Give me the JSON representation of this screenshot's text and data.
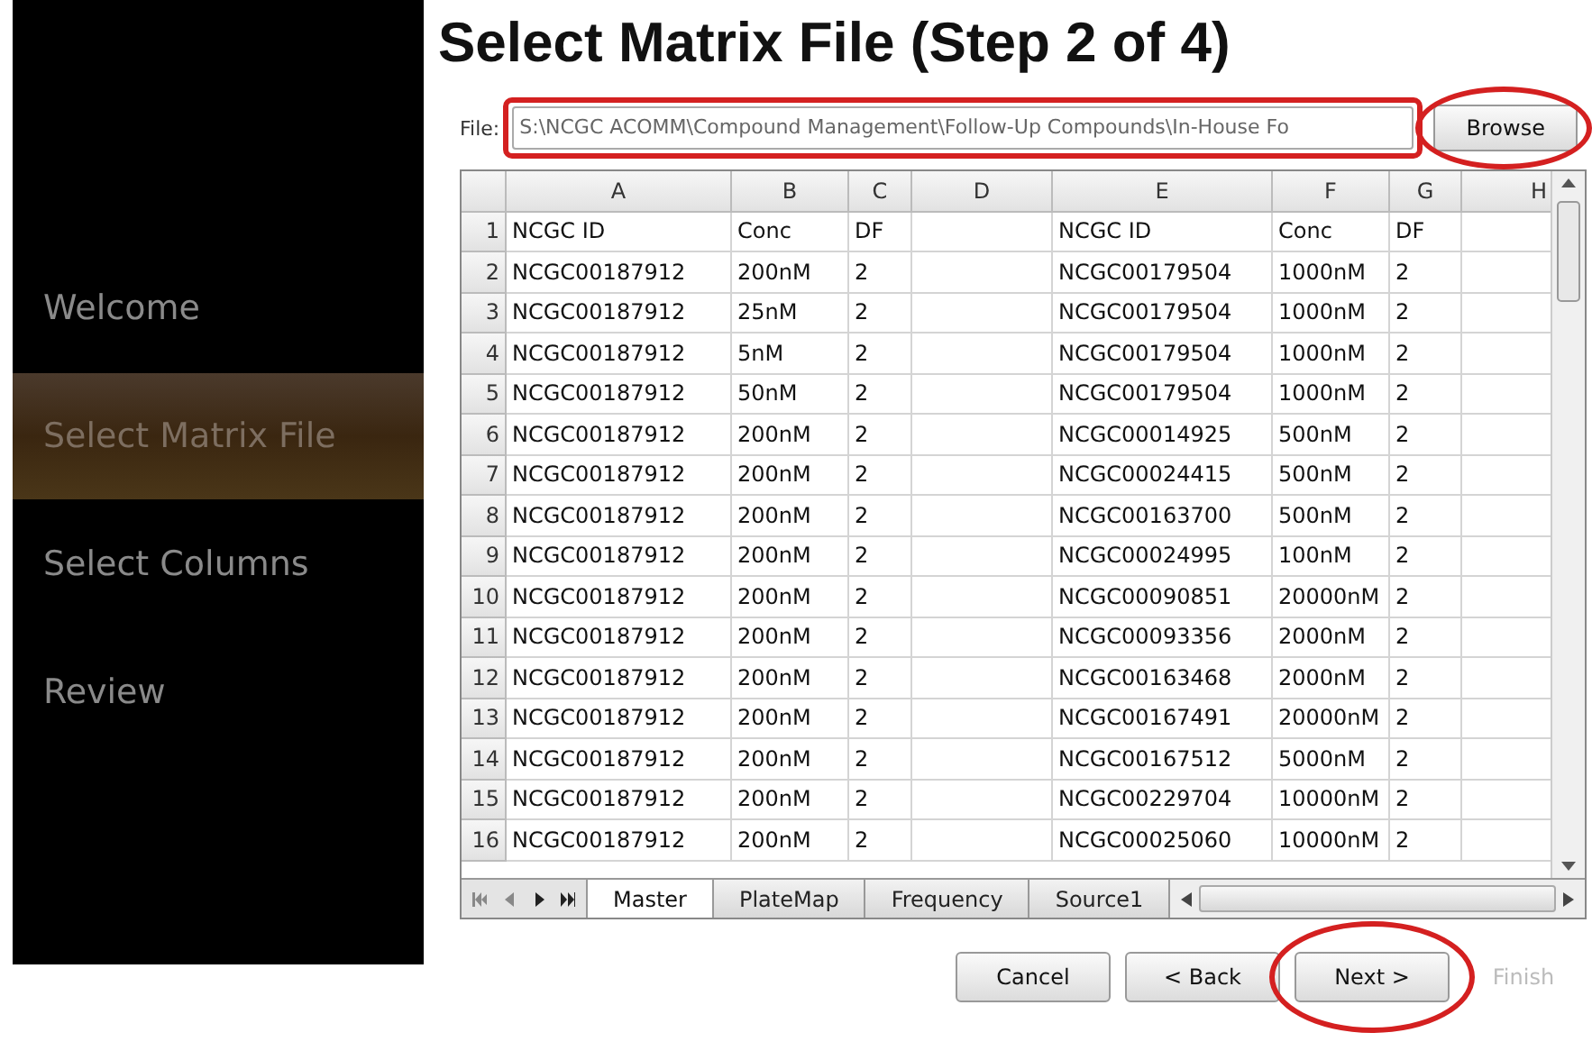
{
  "sidebar": {
    "items": [
      {
        "label": "Welcome",
        "selected": false
      },
      {
        "label": "Select Matrix File",
        "selected": true
      },
      {
        "label": "Select Columns",
        "selected": false
      },
      {
        "label": "Review",
        "selected": false
      }
    ]
  },
  "title": "Select Matrix File (Step 2 of 4)",
  "file": {
    "label": "File:",
    "value": "S:\\NCGC ACOMM\\Compound Management\\Follow-Up Compounds\\In-House Fo",
    "highlighted": true
  },
  "browse_button": {
    "label": "Browse",
    "highlighted": true
  },
  "table": {
    "columns": [
      "A",
      "B",
      "C",
      "D",
      "E",
      "F",
      "G",
      "H"
    ],
    "rows": [
      {
        "number": "1",
        "cells": [
          "NCGC ID",
          "Conc",
          "DF",
          "",
          "NCGC ID",
          "Conc",
          "DF",
          ""
        ]
      },
      {
        "number": "2",
        "cells": [
          "NCGC00187912",
          "200nM",
          "2",
          "",
          "NCGC00179504",
          "1000nM",
          "2",
          ""
        ]
      },
      {
        "number": "3",
        "cells": [
          "NCGC00187912",
          "25nM",
          "2",
          "",
          "NCGC00179504",
          "1000nM",
          "2",
          ""
        ]
      },
      {
        "number": "4",
        "cells": [
          "NCGC00187912",
          "5nM",
          "2",
          "",
          "NCGC00179504",
          "1000nM",
          "2",
          ""
        ]
      },
      {
        "number": "5",
        "cells": [
          "NCGC00187912",
          "50nM",
          "2",
          "",
          "NCGC00179504",
          "1000nM",
          "2",
          ""
        ]
      },
      {
        "number": "6",
        "cells": [
          "NCGC00187912",
          "200nM",
          "2",
          "",
          "NCGC00014925",
          "500nM",
          "2",
          ""
        ]
      },
      {
        "number": "7",
        "cells": [
          "NCGC00187912",
          "200nM",
          "2",
          "",
          "NCGC00024415",
          "500nM",
          "2",
          ""
        ]
      },
      {
        "number": "8",
        "cells": [
          "NCGC00187912",
          "200nM",
          "2",
          "",
          "NCGC00163700",
          "500nM",
          "2",
          ""
        ]
      },
      {
        "number": "9",
        "cells": [
          "NCGC00187912",
          "200nM",
          "2",
          "",
          "NCGC00024995",
          "100nM",
          "2",
          ""
        ]
      },
      {
        "number": "10",
        "cells": [
          "NCGC00187912",
          "200nM",
          "2",
          "",
          "NCGC00090851",
          "20000nM",
          "2",
          ""
        ]
      },
      {
        "number": "11",
        "cells": [
          "NCGC00187912",
          "200nM",
          "2",
          "",
          "NCGC00093356",
          "2000nM",
          "2",
          ""
        ]
      },
      {
        "number": "12",
        "cells": [
          "NCGC00187912",
          "200nM",
          "2",
          "",
          "NCGC00163468",
          "2000nM",
          "2",
          ""
        ]
      },
      {
        "number": "13",
        "cells": [
          "NCGC00187912",
          "200nM",
          "2",
          "",
          "NCGC00167491",
          "20000nM",
          "2",
          ""
        ]
      },
      {
        "number": "14",
        "cells": [
          "NCGC00187912",
          "200nM",
          "2",
          "",
          "NCGC00167512",
          "5000nM",
          "2",
          ""
        ]
      },
      {
        "number": "15",
        "cells": [
          "NCGC00187912",
          "200nM",
          "2",
          "",
          "NCGC00229704",
          "10000nM",
          "2",
          ""
        ]
      },
      {
        "number": "16",
        "cells": [
          "NCGC00187912",
          "200nM",
          "2",
          "",
          "NCGC00025060",
          "10000nM",
          "2",
          ""
        ]
      }
    ]
  },
  "sheet_tabs": [
    {
      "label": "Master",
      "selected": true
    },
    {
      "label": "PlateMap",
      "selected": false
    },
    {
      "label": "Frequency",
      "selected": false
    },
    {
      "label": "Source1",
      "selected": false
    }
  ],
  "buttons": [
    {
      "label": "Cancel",
      "disabled": false,
      "highlighted": false
    },
    {
      "label": "< Back",
      "disabled": false,
      "highlighted": false
    },
    {
      "label": "Next >",
      "disabled": false,
      "highlighted": true
    },
    {
      "label": "Finish",
      "disabled": true,
      "highlighted": false
    }
  ]
}
